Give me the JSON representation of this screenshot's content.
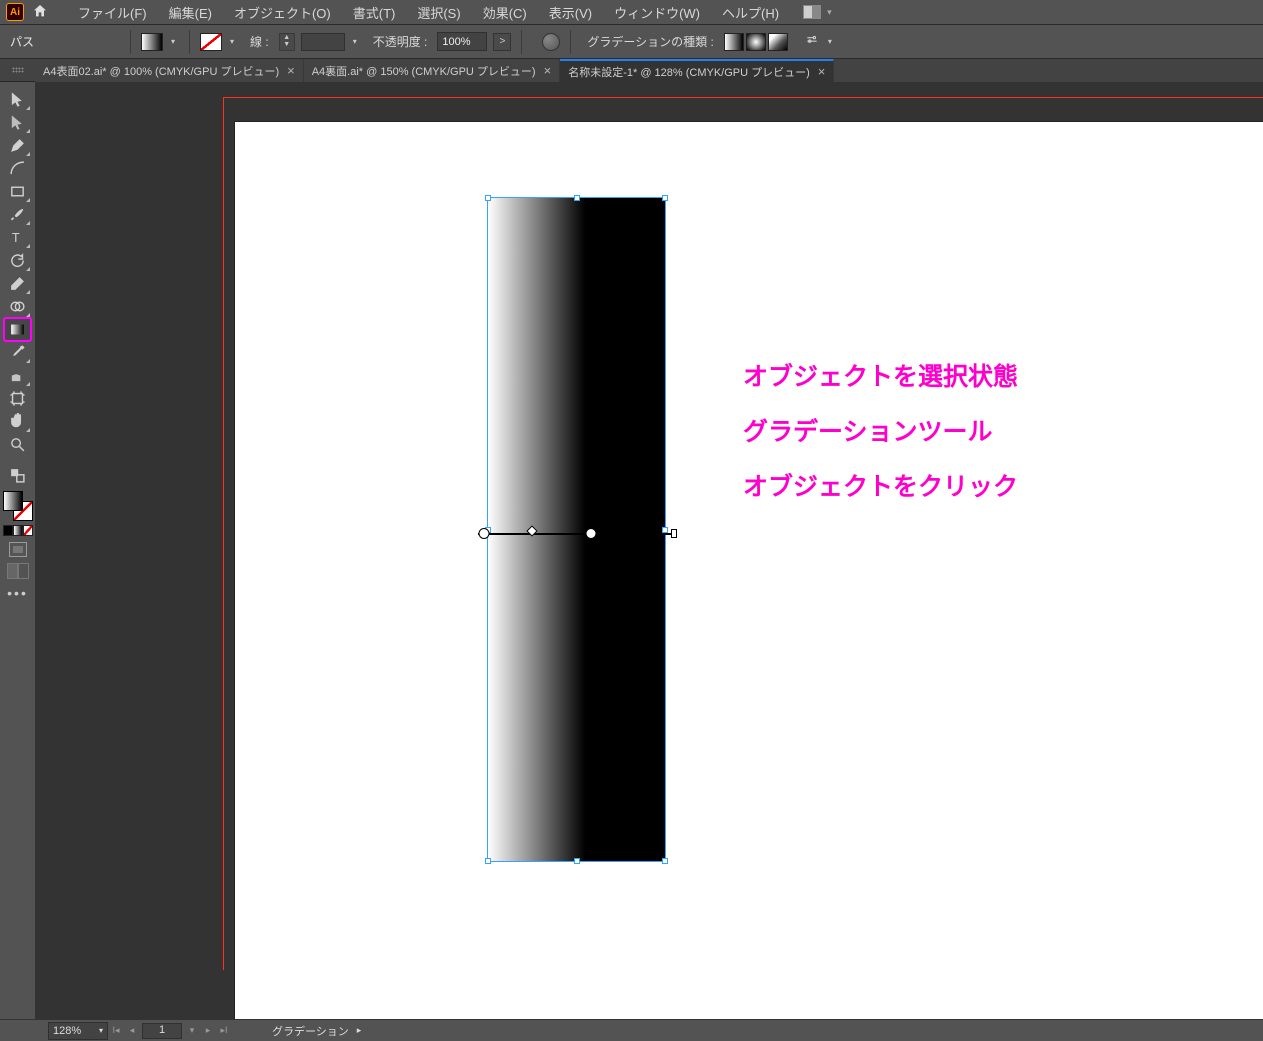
{
  "menu": {
    "items": [
      "ファイル(F)",
      "編集(E)",
      "オブジェクト(O)",
      "書式(T)",
      "選択(S)",
      "効果(C)",
      "表示(V)",
      "ウィンドウ(W)",
      "ヘルプ(H)"
    ]
  },
  "control": {
    "selection_type": "パス",
    "stroke_label": "線 :",
    "opacity_label": "不透明度 :",
    "opacity_value": "100%",
    "gradient_type_label": "グラデーションの種類 :"
  },
  "tabs": [
    {
      "label": "A4表面02.ai* @ 100% (CMYK/GPU プレビュー)",
      "active": false
    },
    {
      "label": "A4裏面.ai* @ 150% (CMYK/GPU プレビュー)",
      "active": false
    },
    {
      "label": "名称未設定-1* @ 128% (CMYK/GPU プレビュー)",
      "active": true
    }
  ],
  "annotation": {
    "line1": "オブジェクトを選択状態",
    "line2": "グラデーションツール",
    "line3": "オブジェクトをクリック"
  },
  "status": {
    "zoom": "128%",
    "page": "1",
    "tool": "グラデーション"
  },
  "close_glyph": "×"
}
